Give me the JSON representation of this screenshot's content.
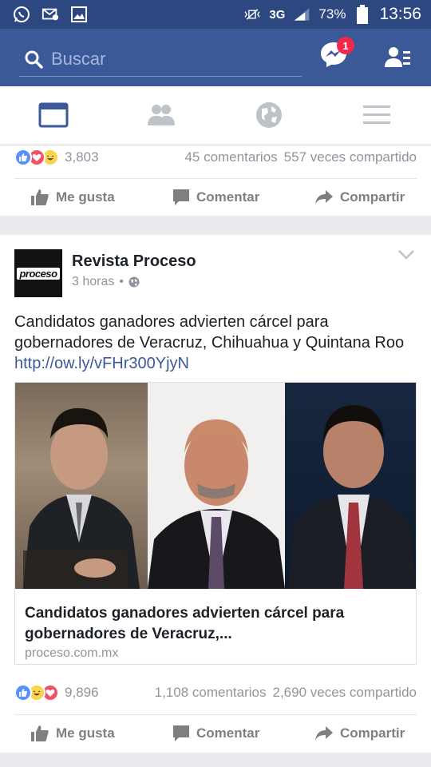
{
  "status_bar": {
    "network": "3G",
    "battery": "73%",
    "time": "13:56",
    "icons": [
      "whatsapp-icon",
      "message-icon",
      "gallery-icon",
      "vibrate-icon",
      "signal-icon",
      "battery-icon"
    ]
  },
  "header": {
    "search_placeholder": "Buscar",
    "messenger_badge": "1"
  },
  "tabs": [
    {
      "name": "news-feed",
      "icon": "newsfeed-icon",
      "active": true
    },
    {
      "name": "friends",
      "icon": "friends-icon",
      "active": false
    },
    {
      "name": "notifications",
      "icon": "globe-icon",
      "active": false
    },
    {
      "name": "menu",
      "icon": "hamburger-icon",
      "active": false
    }
  ],
  "previous_post": {
    "reaction_count": "3,803",
    "comments": "45 comentarios",
    "shares": "557 veces compartido"
  },
  "actions": {
    "like": "Me gusta",
    "comment": "Comentar",
    "share": "Compartir"
  },
  "post": {
    "author": "Revista Proceso",
    "avatar_text": "proceso",
    "time": "3 horas",
    "separator": "•",
    "text": "Candidatos ganadores advierten cárcel para gobernadores de Veracruz, Chihuahua y Quintana Roo",
    "link": "http://ow.ly/vFHr300YjyN",
    "link_card": {
      "title": "Candidatos ganadores advierten cárcel para gobernadores de Veracruz,...",
      "domain": "proceso.com.mx"
    },
    "reaction_count": "9,896",
    "comments": "1,108 comentarios",
    "shares": "2,690 veces compartido"
  },
  "colors": {
    "brand": "#3b5998",
    "status_bar": "#2d4780",
    "like_blue": "#5890ff",
    "love_red": "#f25268",
    "haha_yellow": "#fcd34d",
    "badge_red": "#f02849"
  }
}
